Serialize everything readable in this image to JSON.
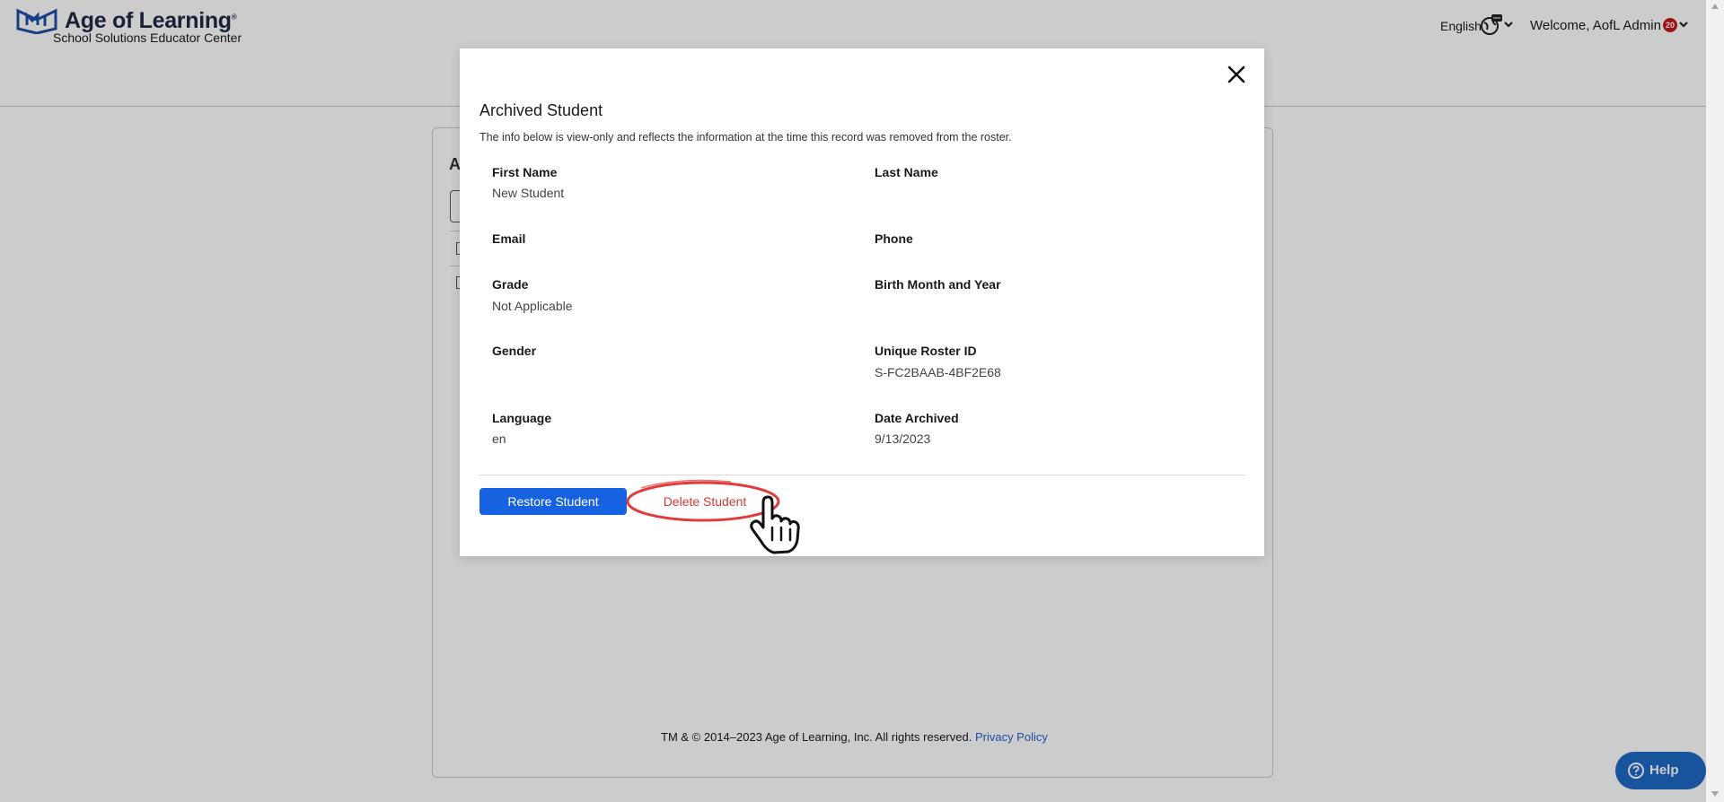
{
  "header": {
    "brand_title": "Age of Learning",
    "brand_registered": "®",
    "brand_subtitle": "School Solutions Educator Center",
    "language": "English",
    "welcome": "Welcome, AofL Admin",
    "notification_count": "20"
  },
  "page": {
    "card_title_partial": "A"
  },
  "modal": {
    "title": "Archived Student",
    "description": "The info below is view-only and reflects the information at the time this record was removed from the roster.",
    "fields": {
      "first_name": {
        "label": "First Name",
        "value": "New Student"
      },
      "last_name": {
        "label": "Last Name",
        "value": ""
      },
      "email": {
        "label": "Email",
        "value": ""
      },
      "phone": {
        "label": "Phone",
        "value": ""
      },
      "grade": {
        "label": "Grade",
        "value": "Not Applicable"
      },
      "birth": {
        "label": "Birth Month and Year",
        "value": ""
      },
      "gender": {
        "label": "Gender",
        "value": ""
      },
      "roster_id": {
        "label": "Unique Roster ID",
        "value": "S-FC2BAAB-4BF2E68"
      },
      "language": {
        "label": "Language",
        "value": "en"
      },
      "date_archived": {
        "label": "Date Archived",
        "value": "9/13/2023"
      }
    },
    "restore_label": "Restore Student",
    "delete_label": "Delete Student"
  },
  "footer": {
    "copyright": "TM & © 2014–2023 Age of Learning, Inc. All rights reserved. ",
    "privacy_link": "Privacy Policy"
  },
  "help": {
    "label": "Help"
  },
  "colors": {
    "primary": "#1662e0",
    "danger": "#d23a3a",
    "help": "#1f69c6",
    "badge": "#c21818",
    "annotation": "#e03c3c"
  },
  "icons": [
    "logo-icon",
    "globe-icon",
    "chevron-down-icon",
    "close-icon",
    "help-icon",
    "hand-cursor-icon"
  ]
}
